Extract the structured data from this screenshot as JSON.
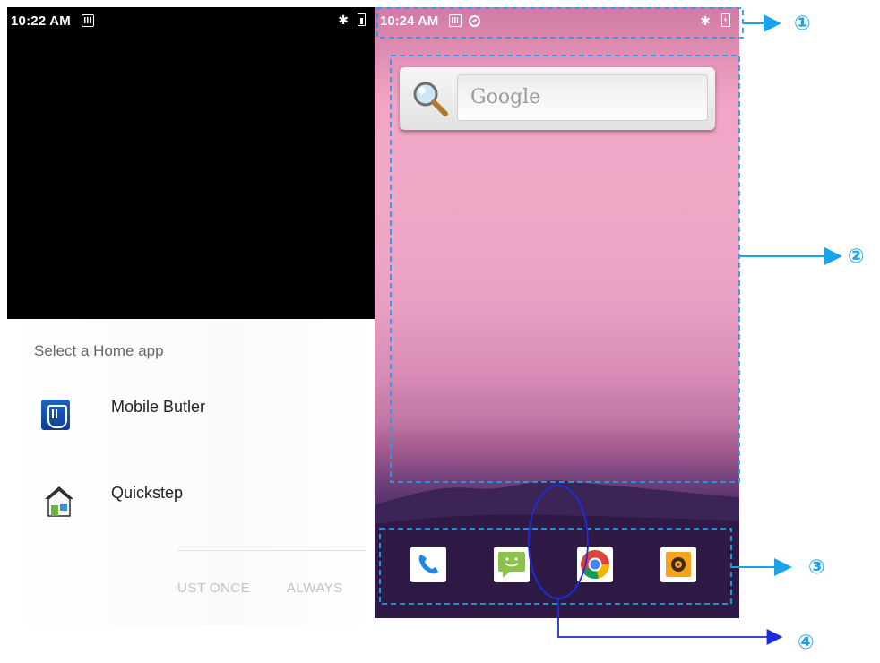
{
  "left_phone": {
    "status_bar": {
      "time": "10:22 AM"
    },
    "chooser": {
      "title": "Select a Home app",
      "apps": [
        {
          "label": "Mobile Butler",
          "icon": "mobile-butler-icon"
        },
        {
          "label": "Quickstep",
          "icon": "quickstep-house-icon"
        }
      ],
      "buttons": {
        "just_once": "UST ONCE",
        "always": "ALWAYS"
      }
    }
  },
  "right_phone": {
    "status_bar": {
      "time": "10:24 AM"
    },
    "search_widget": {
      "placeholder": "Google"
    },
    "dock": [
      {
        "icon": "phone-icon",
        "color": "#1e88e5"
      },
      {
        "icon": "messaging-icon",
        "color": "#8bc34a"
      },
      {
        "icon": "chrome-icon",
        "color": "#db4437"
      },
      {
        "icon": "music-icon",
        "color": "#f7a21b"
      }
    ]
  },
  "annotations": {
    "labels": [
      "①",
      "②",
      "③",
      "④"
    ],
    "color": "#1aa3e8",
    "arrow_color": "#1c2de0"
  }
}
